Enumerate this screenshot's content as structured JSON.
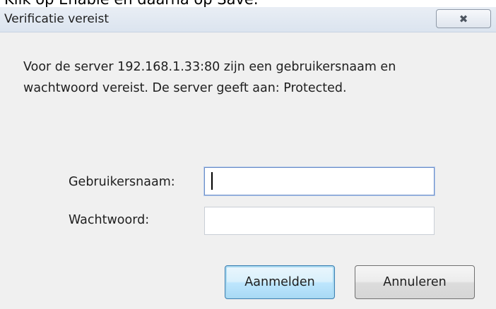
{
  "page": {
    "caption": "Klik op Enable en daarna op Save."
  },
  "dialog": {
    "title": "Verificatie vereist",
    "close_icon": "close-icon",
    "message": "Voor de server 192.168.1.33:80 zijn een gebruikersnaam en wachtwoord vereist. De server geeft aan: Protected.",
    "username_label": "Gebruikersnaam:",
    "username_value": "",
    "password_label": "Wachtwoord:",
    "password_value": "",
    "login_button": "Aanmelden",
    "cancel_button": "Annuleren"
  }
}
